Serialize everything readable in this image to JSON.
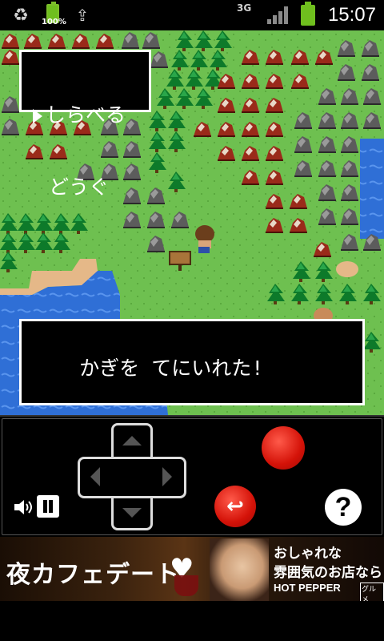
{
  "statusbar": {
    "battery_percent": "100%",
    "network_type": "3G",
    "time": "15:07"
  },
  "game": {
    "menu_line1": "しらべる",
    "menu_line2": "どうぐ",
    "message": "かぎを てにいれた!"
  },
  "controls": {
    "back_symbol": "↩",
    "help_symbol": "?"
  },
  "ad": {
    "headline": "夜カフェデート",
    "line1": "おしゃれな",
    "line2": "雰囲気のお店なら",
    "brand": "HOT PEPPER",
    "brand_sub": "グルメ"
  }
}
